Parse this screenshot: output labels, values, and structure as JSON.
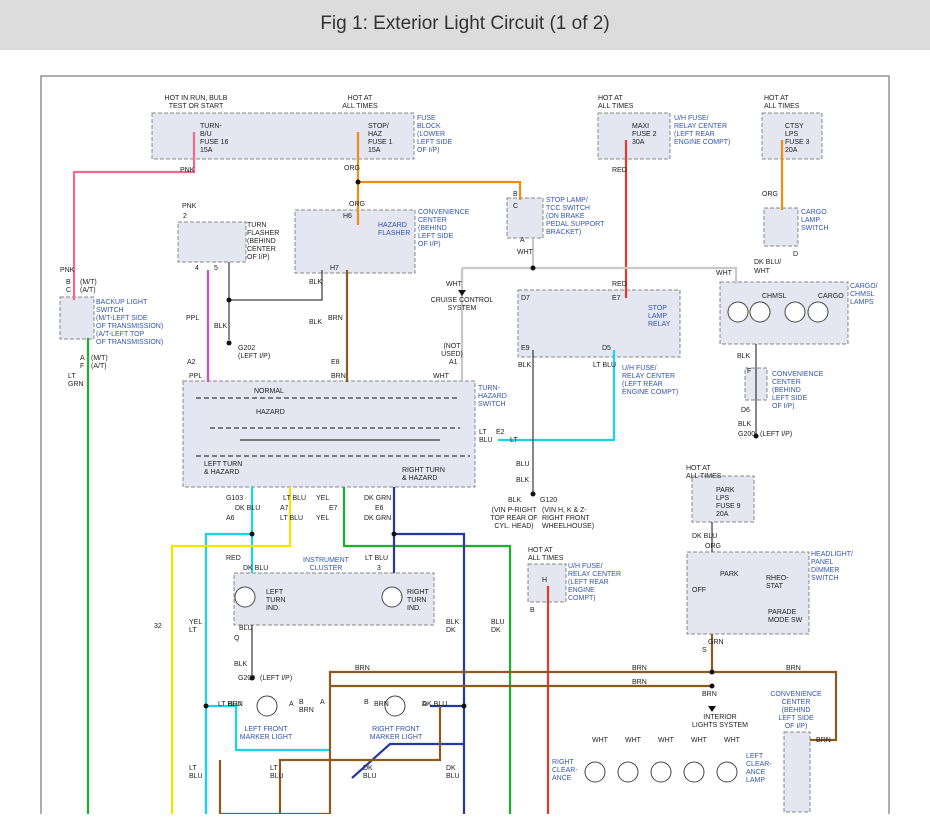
{
  "title": "Fig 1: Exterior Light Circuit (1 of 2)",
  "colors": {
    "pink": "#f06a8c",
    "orange": "#f08c14",
    "red": "#e23a2a",
    "violet": "#d24ad2",
    "brown": "#8b5a1e",
    "gray": "#c8c8c8",
    "cyan": "#19d3e6",
    "yellow": "#f2e600",
    "green": "#18b228",
    "navy": "#2438a4",
    "label_blue": "#3355aa",
    "box_fill": "#e4e6f2"
  },
  "labels": {
    "hot_run_bulb": [
      "HOT IN RUN, BULB",
      "TEST OR START"
    ],
    "hot_all_times": [
      "HOT AT",
      "ALL TIMES"
    ],
    "fuse_block": [
      "FUSE",
      "BLOCK",
      "(LOWER",
      "LEFT SIDE",
      "OF I/P)"
    ],
    "turn_fuse": [
      "TURN-",
      "B/U",
      "FUSE 16",
      "15A"
    ],
    "stop_fuse": [
      "STOP/",
      "HAZ",
      "FUSE 1",
      "15A"
    ],
    "maxi_fuse": [
      "MAXI",
      "FUSE 2",
      "30A"
    ],
    "uh_relay_center_top": [
      "U/H FUSE/",
      "RELAY CENTER",
      "(LEFT REAR",
      "ENGINE COMPT)"
    ],
    "ctsy_fuse": [
      "CTSY",
      "LPS",
      "FUSE 3",
      "20A"
    ],
    "turn_flasher": [
      "TURN",
      "FLASHER",
      "(BEHIND",
      "CENTER",
      "OF I/P)"
    ],
    "hazard_flasher": [
      "HAZARD",
      "FLASHER"
    ],
    "convenience_center_top": [
      "CONVENIENCE",
      "CENTER",
      "(BEHIND",
      "LEFT SIDE",
      "OF I/P)"
    ],
    "stop_lamp_switch": [
      "STOP LAMP/",
      "TCC SWITCH",
      "(ON BRAKE",
      "PEDAL SUPPORT",
      "BRACKET)"
    ],
    "cargo_lamp_switch": [
      "CARGO",
      "LAMP",
      "SWITCH"
    ],
    "cargo_chmsl_lamps": [
      "CARGO/",
      "CHMSL",
      "LAMPS"
    ],
    "chmsl": "CHMSL",
    "cargo": "CARGO",
    "backup_switch": [
      "BACKUP LIGHT",
      "SWITCH",
      "(M/T-LEFT SIDE",
      "OF TRANSMISSION)",
      "(A/T-LEFT TOP",
      "OF TRANSMISSION)"
    ],
    "cruise_control": [
      "CRUISE CONTROL",
      "SYSTEM"
    ],
    "stop_lamp_relay": [
      "STOP",
      "LAMP",
      "RELAY"
    ],
    "uh_relay_center_mid": [
      "U/H FUSE/",
      "RELAY CENTER",
      "(LEFT REAR",
      "ENGINE COMPT)"
    ],
    "convenience_center_right": [
      "CONVENIENCE",
      "CENTER",
      "(BEHIND",
      "LEFT SIDE",
      "OF I/P)"
    ],
    "g200_left": "G200",
    "left_ip": "(LEFT I/P)",
    "g202": [
      "G202",
      "(LEFT I/P)"
    ],
    "not_used": [
      "(NOT",
      "USED)"
    ],
    "turn_hazard_switch": [
      "TURN-",
      "HAZARD",
      "SWITCH"
    ],
    "normal": "NORMAL",
    "hazard": "HAZARD",
    "left_turn_hazard": [
      "LEFT TURN",
      "& HAZARD"
    ],
    "right_turn_hazard": [
      "RIGHT TURN",
      "& HAZARD"
    ],
    "park_fuse": [
      "PARK",
      "LPS",
      "FUSE 9",
      "20A"
    ],
    "g120_label": [
      "(VIN P-RIGHT",
      "TOP REAR OF",
      "CYL. HEAD)"
    ],
    "g103_label": [
      "(VIN H, K & Z-",
      "RIGHT FRONT",
      "WHEELHOUSE)"
    ],
    "uh_relay_center_low": [
      "U/H FUSE/",
      "RELAY CENTER",
      "(LEFT REAR",
      "ENGINE",
      "COMPT)"
    ],
    "headlight_switch": [
      "HEADLIGHT/",
      "PANEL",
      "DIMMER",
      "SWITCH"
    ],
    "switch_positions": [
      "PARK",
      "OFF",
      "RHEO-",
      "STAT"
    ],
    "parade_mode": [
      "PARADE",
      "MODE SW"
    ],
    "instrument_cluster": [
      "INSTRUMENT",
      "CLUSTER"
    ],
    "left_turn_ind": [
      "LEFT",
      "TURN",
      "IND."
    ],
    "right_turn_ind": [
      "RIGHT",
      "TURN",
      "IND."
    ],
    "left_front_marker": [
      "LEFT FRONT",
      "MARKER LIGHT"
    ],
    "right_front_marker": [
      "RIGHT FRONT",
      "MARKER LIGHT"
    ],
    "interior_lights": [
      "INTERIOR",
      "LIGHTS SYSTEM"
    ],
    "convenience_center_bottom": [
      "CONVENIENCE",
      "CENTER",
      "(BEHIND",
      "LEFT SIDE",
      "OF I/P)"
    ],
    "right_clearance": [
      "RIGHT",
      "CLEAR-",
      "ANCE"
    ],
    "left_clearance": [
      "LEFT",
      "CLEAR-",
      "ANCE",
      "LAMP"
    ]
  },
  "wire_labels": [
    {
      "id": "w1",
      "text": "PNK"
    },
    {
      "id": "w2",
      "text": "ORG"
    },
    {
      "id": "w3",
      "text": "ORG"
    },
    {
      "id": "w4",
      "text": "RED"
    },
    {
      "id": "w5",
      "text": "ORG"
    },
    {
      "id": "w6",
      "text": "PNK"
    },
    {
      "id": "w7",
      "text": "PNK"
    },
    {
      "id": "w8",
      "text": "B"
    },
    {
      "id": "w9",
      "text": "C"
    },
    {
      "id": "w10",
      "text": "(M/T)"
    },
    {
      "id": "w11",
      "text": "(A/T)"
    },
    {
      "id": "w12",
      "text": "2"
    },
    {
      "id": "w13",
      "text": "H6"
    },
    {
      "id": "w14",
      "text": "B"
    },
    {
      "id": "w15",
      "text": "C"
    },
    {
      "id": "w16",
      "text": "A"
    },
    {
      "id": "w17",
      "text": "WHT"
    },
    {
      "id": "w18",
      "text": "WHT"
    },
    {
      "id": "w19",
      "text": "RED"
    },
    {
      "id": "w20",
      "text": "WHT"
    },
    {
      "id": "w21",
      "text": "D"
    },
    {
      "id": "w22",
      "text": "DK BLU/"
    },
    {
      "id": "w23",
      "text": "WHT"
    },
    {
      "id": "w24",
      "text": "4"
    },
    {
      "id": "w25",
      "text": "5"
    },
    {
      "id": "w26",
      "text": "BLK"
    },
    {
      "id": "w27",
      "text": "H7"
    },
    {
      "id": "w28",
      "text": "D7"
    },
    {
      "id": "w29",
      "text": "E7"
    },
    {
      "id": "w30",
      "text": "BLK"
    },
    {
      "id": "w31",
      "text": "BLK"
    },
    {
      "id": "w32",
      "text": "PPL"
    },
    {
      "id": "w33",
      "text": "BRN"
    },
    {
      "id": "w34",
      "text": "E9"
    },
    {
      "id": "w35",
      "text": "D5"
    },
    {
      "id": "w36",
      "text": "BLK"
    },
    {
      "id": "w37",
      "text": "LT BLU"
    },
    {
      "id": "w38",
      "text": "A"
    },
    {
      "id": "w39",
      "text": "(M/T)"
    },
    {
      "id": "w40",
      "text": "F"
    },
    {
      "id": "w41",
      "text": "(A/T)"
    },
    {
      "id": "w42",
      "text": "LT"
    },
    {
      "id": "w43",
      "text": "GRN"
    },
    {
      "id": "w44",
      "text": "A2"
    },
    {
      "id": "w45",
      "text": "PPL"
    },
    {
      "id": "w46",
      "text": "E8"
    },
    {
      "id": "w47",
      "text": "BRN"
    },
    {
      "id": "w48",
      "text": "A1"
    },
    {
      "id": "w49",
      "text": "WHT"
    },
    {
      "id": "w50",
      "text": "F"
    },
    {
      "id": "w51",
      "text": "BLK"
    },
    {
      "id": "w52",
      "text": "D6"
    },
    {
      "id": "w53",
      "text": "BLK"
    },
    {
      "id": "w54",
      "text": "LT"
    },
    {
      "id": "w55",
      "text": "BLU"
    },
    {
      "id": "w56",
      "text": "E2"
    },
    {
      "id": "w57",
      "text": "LT"
    },
    {
      "id": "w58",
      "text": "BLU"
    },
    {
      "id": "w59",
      "text": "BLK"
    },
    {
      "id": "w60",
      "text": "BLK"
    },
    {
      "id": "w61",
      "text": "G120"
    },
    {
      "id": "w62",
      "text": "G103"
    },
    {
      "id": "w63",
      "text": "LT BLU"
    },
    {
      "id": "w64",
      "text": "YEL"
    },
    {
      "id": "w65",
      "text": "DK GRN"
    },
    {
      "id": "w66",
      "text": "DK BLU"
    },
    {
      "id": "w67",
      "text": "A7"
    },
    {
      "id": "w68",
      "text": "E7"
    },
    {
      "id": "w69",
      "text": "E6"
    },
    {
      "id": "w70",
      "text": "A6"
    },
    {
      "id": "w71",
      "text": "LT BLU"
    },
    {
      "id": "w72",
      "text": "YEL"
    },
    {
      "id": "w73",
      "text": "DK GRN"
    },
    {
      "id": "w74",
      "text": "DK BLU"
    },
    {
      "id": "w75",
      "text": "ORG"
    },
    {
      "id": "w76",
      "text": "H"
    },
    {
      "id": "w77",
      "text": "B"
    },
    {
      "id": "w78",
      "text": "RED"
    },
    {
      "id": "w79",
      "text": "LT BLU"
    },
    {
      "id": "w80",
      "text": "DK BLU"
    },
    {
      "id": "w81",
      "text": "3"
    },
    {
      "id": "w82",
      "text": "32"
    },
    {
      "id": "w83",
      "text": "YEL"
    },
    {
      "id": "w84",
      "text": "LT"
    },
    {
      "id": "w85",
      "text": "BLU"
    },
    {
      "id": "w86",
      "text": "Q"
    },
    {
      "id": "w87",
      "text": "BLK"
    },
    {
      "id": "w88",
      "text": "BLK"
    },
    {
      "id": "w89",
      "text": "DK"
    },
    {
      "id": "w90",
      "text": "BLU"
    },
    {
      "id": "w91",
      "text": "DK"
    },
    {
      "id": "w92",
      "text": "GRN"
    },
    {
      "id": "w93",
      "text": "S"
    },
    {
      "id": "w94",
      "text": "BRN"
    },
    {
      "id": "w95",
      "text": "BRN"
    },
    {
      "id": "w96",
      "text": "BRN"
    },
    {
      "id": "w97",
      "text": "BRN"
    },
    {
      "id": "w98",
      "text": "BRN"
    },
    {
      "id": "w99",
      "text": "BRN"
    },
    {
      "id": "w100",
      "text": "LT BLU"
    },
    {
      "id": "w101",
      "text": "A"
    },
    {
      "id": "w102",
      "text": "B"
    },
    {
      "id": "w103",
      "text": "BRN"
    },
    {
      "id": "w104",
      "text": "BRN"
    },
    {
      "id": "w105",
      "text": "B"
    },
    {
      "id": "w106",
      "text": "A"
    },
    {
      "id": "w107",
      "text": "DK BLU"
    },
    {
      "id": "w108",
      "text": "A"
    },
    {
      "id": "w109",
      "text": "BRN"
    },
    {
      "id": "w110",
      "text": "LT"
    },
    {
      "id": "w111",
      "text": "BLU"
    },
    {
      "id": "w112",
      "text": "LT"
    },
    {
      "id": "w113",
      "text": "BLU"
    },
    {
      "id": "w114",
      "text": "DK"
    },
    {
      "id": "w115",
      "text": "BLU"
    },
    {
      "id": "w116",
      "text": "DK"
    },
    {
      "id": "w117",
      "text": "BLU"
    },
    {
      "id": "w118",
      "text": "WHT"
    },
    {
      "id": "w119",
      "text": "WHT"
    },
    {
      "id": "w120",
      "text": "WHT"
    },
    {
      "id": "w121",
      "text": "WHT"
    },
    {
      "id": "w122",
      "text": "WHT"
    }
  ]
}
